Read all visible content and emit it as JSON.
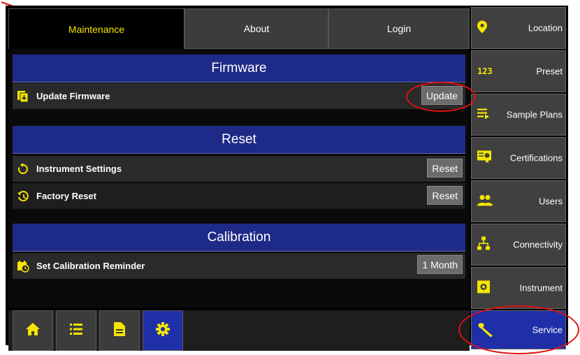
{
  "tabs": [
    {
      "label": "Maintenance",
      "active": true
    },
    {
      "label": "About",
      "active": false
    },
    {
      "label": "Login",
      "active": false
    }
  ],
  "sections": {
    "firmware": {
      "title": "Firmware",
      "rows": [
        {
          "label": "Update Firmware",
          "button": "Update",
          "icon": "firmware-update-icon"
        }
      ]
    },
    "reset": {
      "title": "Reset",
      "rows": [
        {
          "label": "Instrument Settings",
          "button": "Reset",
          "icon": "restore-icon"
        },
        {
          "label": "Factory Reset",
          "button": "Reset",
          "icon": "history-icon"
        }
      ]
    },
    "calibration": {
      "title": "Calibration",
      "rows": [
        {
          "label": "Set Calibration Reminder",
          "button": "1 Month",
          "icon": "calendar-clock-icon"
        }
      ]
    }
  },
  "sidebar": [
    {
      "label": "Location",
      "icon": "location-pin-icon",
      "active": false
    },
    {
      "label": "Preset",
      "icon": "123-icon",
      "active": false
    },
    {
      "label": "Sample Plans",
      "icon": "list-play-icon",
      "active": false
    },
    {
      "label": "Certifications",
      "icon": "certificate-icon",
      "active": false
    },
    {
      "label": "Users",
      "icon": "users-icon",
      "active": false
    },
    {
      "label": "Connectivity",
      "icon": "network-icon",
      "active": false
    },
    {
      "label": "Instrument",
      "icon": "instrument-icon",
      "active": false
    },
    {
      "label": "Service",
      "icon": "wrench-icon",
      "active": true
    }
  ],
  "bottom_nav": [
    {
      "name": "home-icon",
      "active": false
    },
    {
      "name": "list-icon",
      "active": false
    },
    {
      "name": "document-icon",
      "active": false
    },
    {
      "name": "gear-icon",
      "active": true
    }
  ],
  "colors": {
    "accent": "#f5e600",
    "header_blue": "#1e2a87",
    "active_blue": "#1f2fa8",
    "annotation_red": "#e01010"
  }
}
